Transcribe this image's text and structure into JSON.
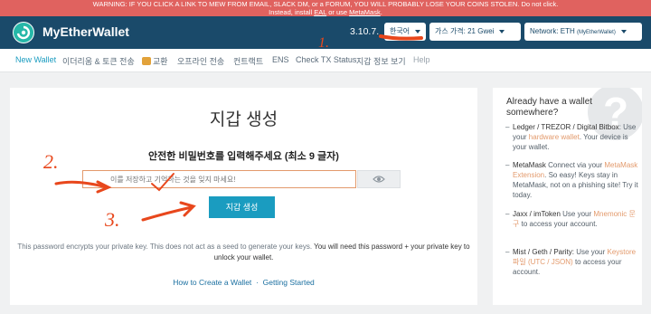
{
  "warning": {
    "line1": "WARNING: IF YOU CLICK A LINK TO MEW FROM EMAIL, SLACK DM, or a FORUM, YOU WILL PROBABLY LOSE YOUR COINS STOLEN. Do not click.",
    "line2_pre": "Instead, install ",
    "line2_link1": "EAL",
    "line2_mid": " or use ",
    "line2_link2": "MetaMask",
    "line2_post": "."
  },
  "header": {
    "brand": "MyEtherWallet",
    "version": "3.10.7.",
    "language": "한국어",
    "gas": "가스 가격: 21 Gwei",
    "network": "Network: ETH",
    "network_sub": "(MyEtherWallet)"
  },
  "nav": [
    {
      "label": "New Wallet"
    },
    {
      "label": "이더리움 & 토큰 전송"
    },
    {
      "label": "교환"
    },
    {
      "label": "오프라인 전송"
    },
    {
      "label": "컨트랙트"
    },
    {
      "label": "ENS"
    },
    {
      "label": "Check TX Status"
    },
    {
      "label": "지갑 정보 보기"
    },
    {
      "label": "Help"
    }
  ],
  "main": {
    "title": "지갑 생성",
    "subtitle": "안전한 비밀번호를 입력해주세요 (최소 9 글자)",
    "password_placeholder": "이를 저장하고 기억하는 것을 잊지 마세요!",
    "create_button": "지갑 생성",
    "explain_plain": "This password encrypts your private key. This does not act as a seed to generate your keys.",
    "explain_bold": "You will need this password + your private key to unlock your wallet.",
    "link_create": "How to Create a Wallet",
    "link_sep": "·",
    "link_start": "Getting Started"
  },
  "sidebar": {
    "heading": "Already have a wallet somewhere?",
    "qmark": "?",
    "items": [
      {
        "head": "Ledger / TREZOR / Digital Bitbox",
        "pre": ": Use your ",
        "link": "hardware wallet",
        "post": ". Your device is your wallet."
      },
      {
        "head": "MetaMask",
        "pre": " Connect via your ",
        "link": "MetaMask Extension",
        "post": ". So easy! Keys stay in MetaMask, not on a phishing site! Try it today."
      },
      {
        "head": "Jaxx / imToken",
        "pre": " Use your ",
        "link": "Mnemonic 문구",
        "post": " to access your account."
      },
      {
        "head": "Mist / Geth / Parity:",
        "pre": " Use your ",
        "link": "Keystore 파일 (UTC / JSON)",
        "post": " to access your account."
      }
    ]
  },
  "annotations": {
    "n1": "1.",
    "n2": "2.",
    "n3": "3.",
    "color": "#e8471c"
  }
}
